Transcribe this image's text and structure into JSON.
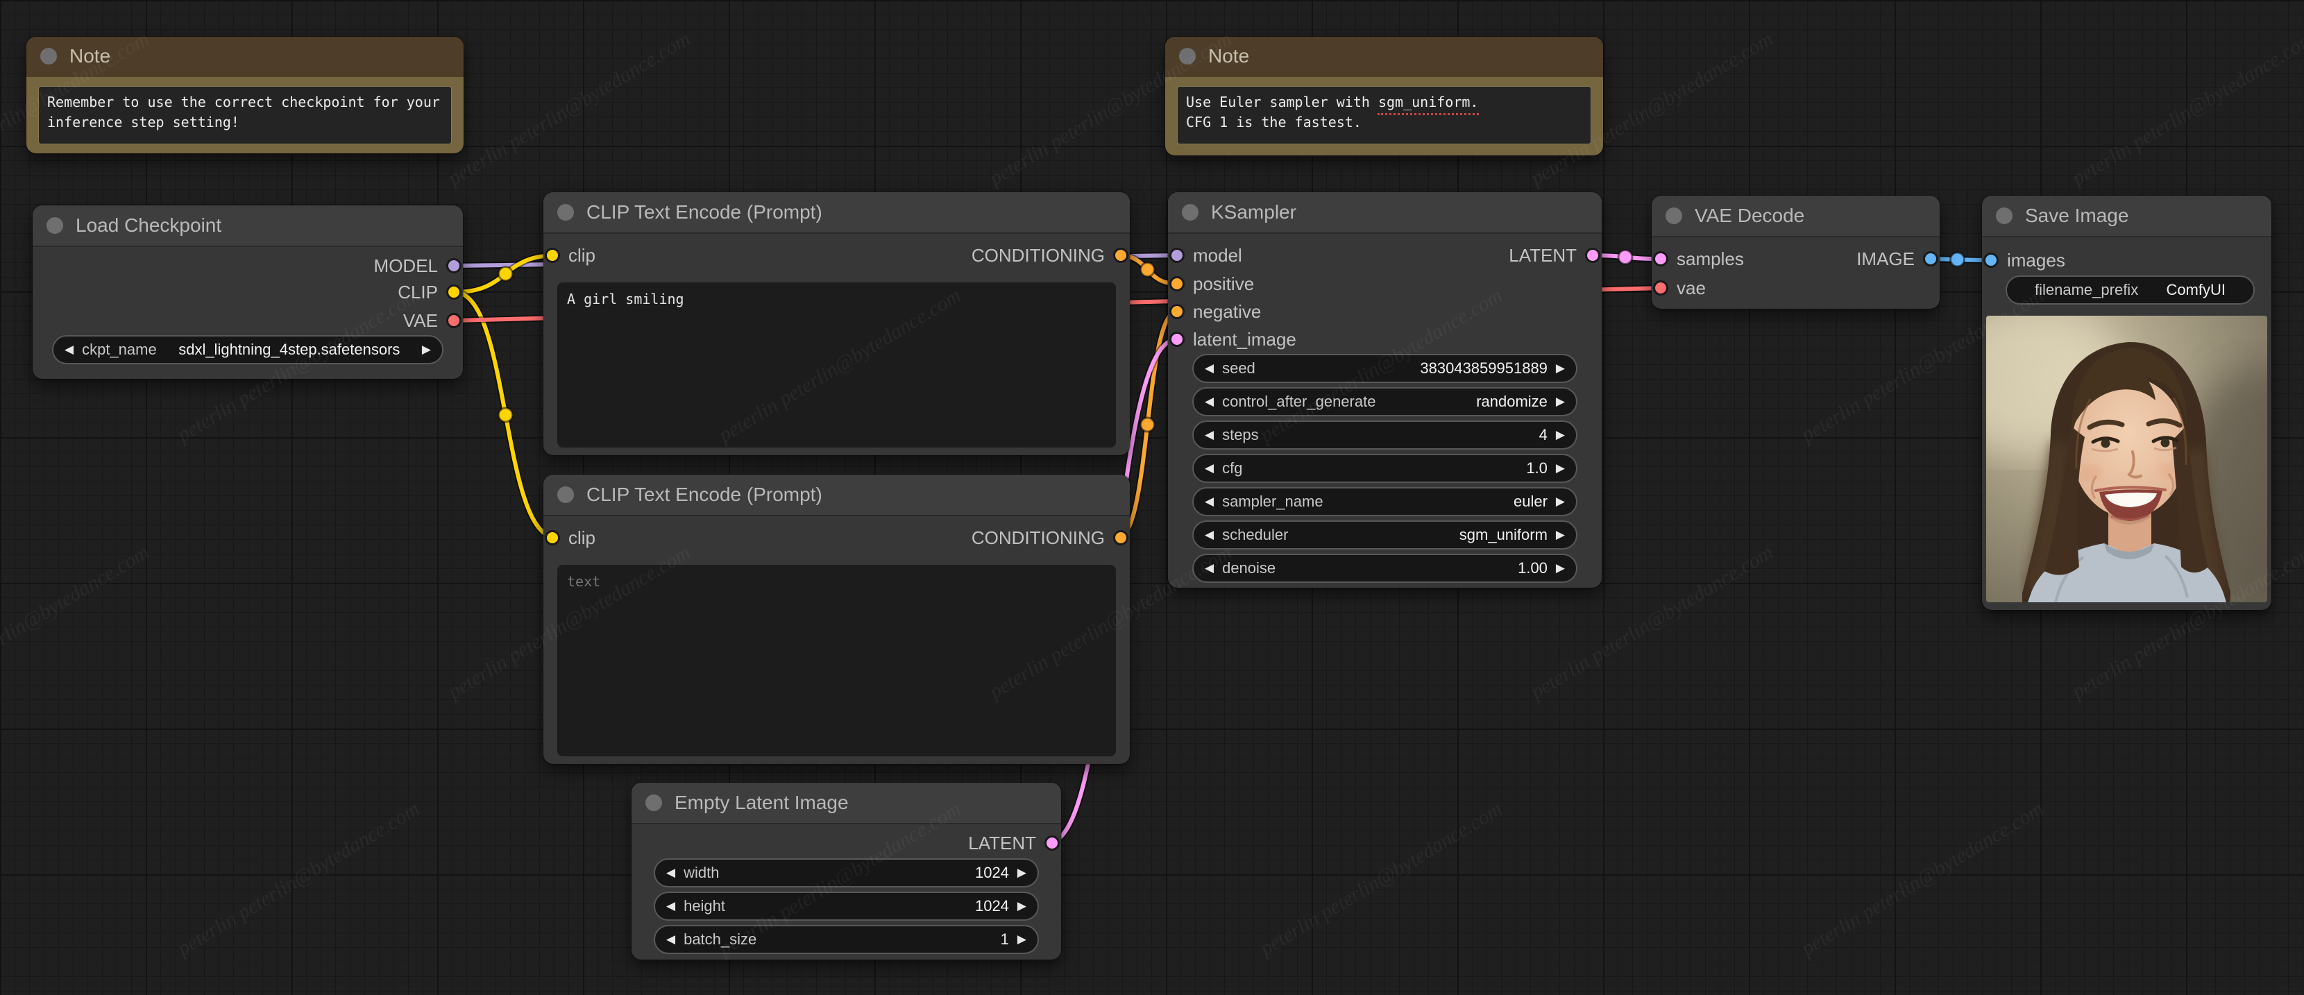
{
  "watermark": "peterlin peterlin@bytedance.com",
  "slot_colors": {
    "MODEL": "#B39DDB",
    "CLIP": "#FFD500",
    "VAE": "#FF6E6E",
    "CONDITIONING": "#FFA931",
    "LATENT": "#FF9CF9",
    "IMAGE": "#64B5F6"
  },
  "nodes": {
    "note1": {
      "title": "Note",
      "text": "Remember to use the correct checkpoint for your\ninference step setting!"
    },
    "note2": {
      "title": "Note",
      "text": "Use Euler sampler with sgm_uniform.\nCFG 1 is the fastest."
    },
    "load_checkpoint": {
      "title": "Load Checkpoint",
      "outputs": [
        "MODEL",
        "CLIP",
        "VAE"
      ],
      "widgets": [
        {
          "label": "ckpt_name",
          "value": "sdxl_lightning_4step.safetensors"
        }
      ]
    },
    "clip_positive": {
      "title": "CLIP Text Encode (Prompt)",
      "inputs": [
        "clip"
      ],
      "outputs": [
        "CONDITIONING"
      ],
      "text": "A girl smiling",
      "placeholder": ""
    },
    "clip_negative": {
      "title": "CLIP Text Encode (Prompt)",
      "inputs": [
        "clip"
      ],
      "outputs": [
        "CONDITIONING"
      ],
      "text": "",
      "placeholder": "text"
    },
    "ksampler": {
      "title": "KSampler",
      "inputs": [
        "model",
        "positive",
        "negative",
        "latent_image"
      ],
      "outputs": [
        "LATENT"
      ],
      "widgets": [
        {
          "label": "seed",
          "value": "383043859951889"
        },
        {
          "label": "control_after_generate",
          "value": "randomize"
        },
        {
          "label": "steps",
          "value": "4"
        },
        {
          "label": "cfg",
          "value": "1.0"
        },
        {
          "label": "sampler_name",
          "value": "euler"
        },
        {
          "label": "scheduler",
          "value": "sgm_uniform"
        },
        {
          "label": "denoise",
          "value": "1.00"
        }
      ]
    },
    "empty_latent": {
      "title": "Empty Latent Image",
      "outputs": [
        "LATENT"
      ],
      "widgets": [
        {
          "label": "width",
          "value": "1024"
        },
        {
          "label": "height",
          "value": "1024"
        },
        {
          "label": "batch_size",
          "value": "1"
        }
      ]
    },
    "vae_decode": {
      "title": "VAE Decode",
      "inputs": [
        "samples",
        "vae"
      ],
      "outputs": [
        "IMAGE"
      ]
    },
    "save_image": {
      "title": "Save Image",
      "inputs": [
        "images"
      ],
      "widgets": [
        {
          "label": "filename_prefix",
          "value": "ComfyUI"
        }
      ]
    }
  }
}
